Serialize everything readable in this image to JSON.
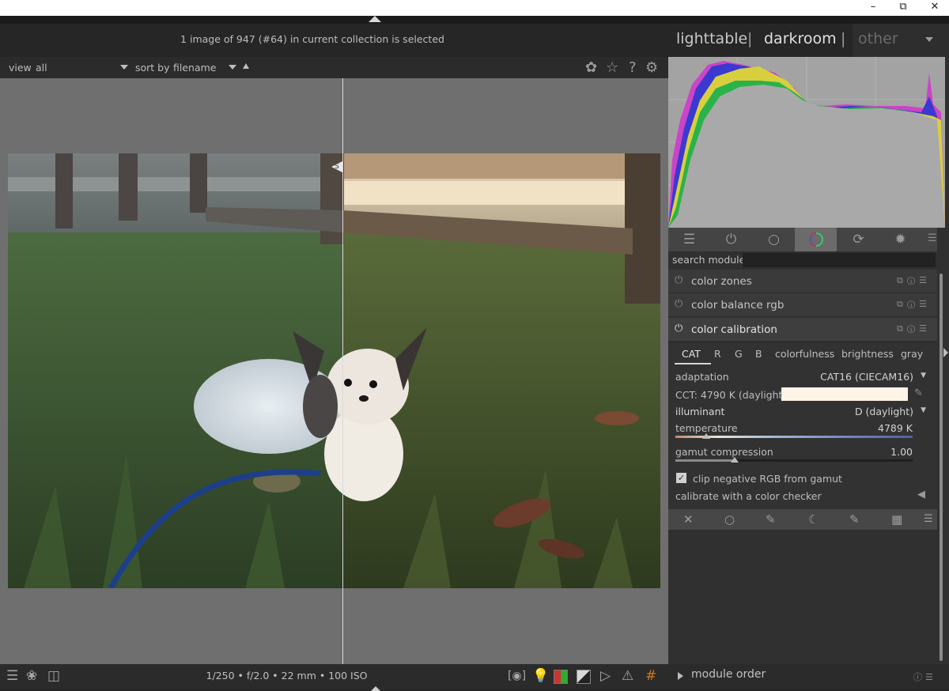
{
  "window": {
    "minimize_icon": "minimize-icon",
    "restore_icon": "restore-icon",
    "close_icon": "close-icon"
  },
  "header": {
    "collection_info": "1 image of 947 (#64) in current collection is selected"
  },
  "views": {
    "lighttable": "lighttable",
    "separator": "|",
    "darkroom": "darkroom",
    "other": "other"
  },
  "toolbar": {
    "view_label": "view",
    "view_value": "all",
    "sort_label": "sort by",
    "sort_value": "filename",
    "icons": [
      "overlays-icon",
      "star-icon",
      "help-icon",
      "gear-icon"
    ]
  },
  "image": {
    "split_marker": "S"
  },
  "bottom": {
    "exif": "1/250 • f/2.0 • 22 mm • 100 ISO"
  },
  "module_tabs": [
    "quick-access-icon",
    "active-modules-icon",
    "base-icon",
    "color-icon",
    "correct-icon",
    "effects-icon"
  ],
  "search": {
    "label": "search module",
    "value": ""
  },
  "modules": [
    {
      "name": "color zones",
      "enabled": false
    },
    {
      "name": "color balance rgb",
      "enabled": false
    },
    {
      "name": "color calibration",
      "enabled": true
    }
  ],
  "color_calibration": {
    "tabs": [
      "CAT",
      "R",
      "G",
      "B",
      "colorfulness",
      "brightness",
      "gray"
    ],
    "active_tab": "CAT",
    "adaptation_label": "adaptation",
    "adaptation_value": "CAT16 (CIECAM16)",
    "cct_label": "CCT: 4790 K (daylight)",
    "illuminant_label": "illuminant",
    "illuminant_value": "D (daylight)",
    "temperature_label": "temperature",
    "temperature_value": "4789 K",
    "temperature_fraction": 0.13,
    "gamut_label": "gamut compression",
    "gamut_value": "1.00",
    "gamut_fraction": 0.25,
    "clip_label": "clip negative RGB from gamut",
    "clip_checked": true,
    "checker_label": "calibrate with a color checker"
  },
  "module_footer_icons": [
    "reset-icon",
    "circle-mask-icon",
    "drawn-mask-icon",
    "parametric-mask-icon",
    "drawn-parametric-mask-icon",
    "raster-mask-icon"
  ],
  "module_order": {
    "label": "module order"
  },
  "bottom_left_icons": [
    "menu-icon",
    "styles-icon",
    "display-icon"
  ],
  "bottom_right_icons": [
    "focus-peaking-icon",
    "lightbulb-icon",
    "color-assessment-icon",
    "clipping-icon",
    "softproof-icon",
    "gamut-check-icon",
    "guides-icon"
  ],
  "colors": {
    "accent_swatch": "#fff4e8",
    "panel_bg": "#303030",
    "canvas_bg": "#6f6f6f"
  }
}
